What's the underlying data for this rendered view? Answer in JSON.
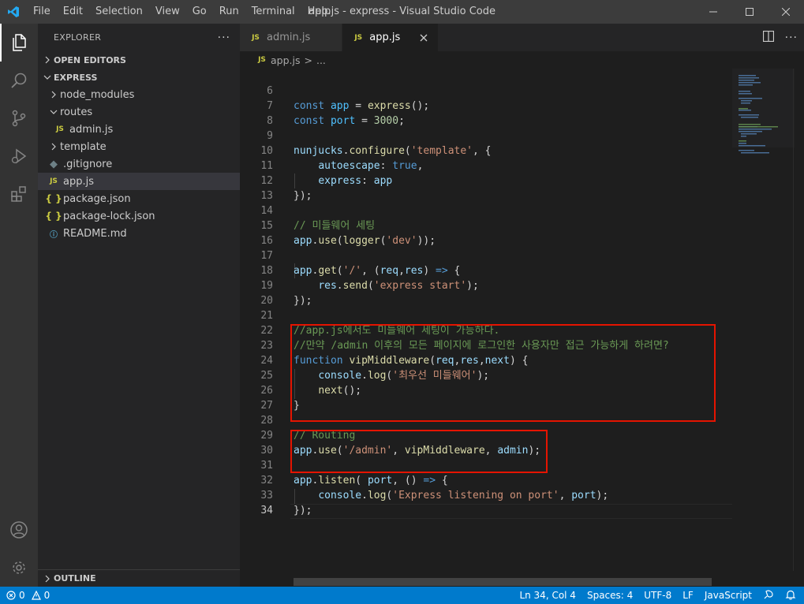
{
  "window": {
    "title": "app.js - express - Visual Studio Code",
    "menu": [
      "File",
      "Edit",
      "Selection",
      "View",
      "Go",
      "Run",
      "Terminal",
      "Help"
    ]
  },
  "sidebar": {
    "title": "EXPLORER",
    "more": "···",
    "open_editors": "OPEN EDITORS",
    "project": "EXPRESS",
    "items": [
      {
        "label": "node_modules",
        "type": "folder",
        "expanded": false
      },
      {
        "label": "routes",
        "type": "folder",
        "expanded": true
      },
      {
        "label": "admin.js",
        "type": "js"
      },
      {
        "label": "template",
        "type": "folder",
        "expanded": false
      },
      {
        "label": ".gitignore",
        "type": "git"
      },
      {
        "label": "app.js",
        "type": "js",
        "selected": true
      },
      {
        "label": "package.json",
        "type": "json"
      },
      {
        "label": "package-lock.json",
        "type": "json"
      },
      {
        "label": "README.md",
        "type": "info"
      }
    ],
    "outline": "OUTLINE",
    "js_badge": "JS",
    "json_badge": "{ }",
    "git_badge": "◆",
    "info_badge": "ⓘ"
  },
  "tabs": [
    {
      "label": "admin.js",
      "active": false
    },
    {
      "label": "app.js",
      "active": true
    }
  ],
  "breadcrumb": {
    "file": "app.js",
    "sep": ">",
    "rest": "..."
  },
  "editor": {
    "lines": [
      {
        "n": "6",
        "tokens": []
      },
      {
        "n": "7",
        "tokens": [
          [
            "kw",
            "const "
          ],
          [
            "var",
            "app"
          ],
          [
            "pl",
            " = "
          ],
          [
            "fn",
            "express"
          ],
          [
            "pl",
            "();"
          ]
        ]
      },
      {
        "n": "8",
        "tokens": [
          [
            "kw",
            "const "
          ],
          [
            "var",
            "port"
          ],
          [
            "pl",
            " = "
          ],
          [
            "num",
            "3000"
          ],
          [
            "pl",
            ";"
          ]
        ]
      },
      {
        "n": "9",
        "tokens": []
      },
      {
        "n": "10",
        "tokens": [
          [
            "prop",
            "nunjucks"
          ],
          [
            "pl",
            "."
          ],
          [
            "fn",
            "configure"
          ],
          [
            "pl",
            "("
          ],
          [
            "str",
            "'template'"
          ],
          [
            "pl",
            ", {"
          ]
        ]
      },
      {
        "n": "11",
        "tokens": [
          [
            "pl",
            "    "
          ],
          [
            "prop",
            "autoescape"
          ],
          [
            "pl",
            ": "
          ],
          [
            "kw",
            "true"
          ],
          [
            "pl",
            ","
          ]
        ]
      },
      {
        "n": "12",
        "tokens": [
          [
            "pl",
            "    "
          ],
          [
            "prop",
            "express"
          ],
          [
            "pl",
            ": "
          ],
          [
            "prop",
            "app"
          ]
        ]
      },
      {
        "n": "13",
        "tokens": [
          [
            "pl",
            "});"
          ]
        ]
      },
      {
        "n": "14",
        "tokens": []
      },
      {
        "n": "15",
        "tokens": [
          [
            "cm",
            "// 미들웨어 세팅"
          ]
        ]
      },
      {
        "n": "16",
        "tokens": [
          [
            "prop",
            "app"
          ],
          [
            "pl",
            "."
          ],
          [
            "fn",
            "use"
          ],
          [
            "pl",
            "("
          ],
          [
            "fn",
            "logger"
          ],
          [
            "pl",
            "("
          ],
          [
            "str",
            "'dev'"
          ],
          [
            "pl",
            "));"
          ]
        ]
      },
      {
        "n": "17",
        "tokens": []
      },
      {
        "n": "18",
        "tokens": [
          [
            "prop",
            "app"
          ],
          [
            "pl",
            "."
          ],
          [
            "fn",
            "get"
          ],
          [
            "pl",
            "("
          ],
          [
            "str",
            "'/'"
          ],
          [
            "pl",
            ", ("
          ],
          [
            "prop",
            "req"
          ],
          [
            "pl",
            ","
          ],
          [
            "prop",
            "res"
          ],
          [
            "pl",
            ") "
          ],
          [
            "kw",
            "=>"
          ],
          [
            "pl",
            " {"
          ]
        ]
      },
      {
        "n": "19",
        "tokens": [
          [
            "pl",
            "    "
          ],
          [
            "prop",
            "res"
          ],
          [
            "pl",
            "."
          ],
          [
            "fn",
            "send"
          ],
          [
            "pl",
            "("
          ],
          [
            "str",
            "'express start'"
          ],
          [
            "pl",
            ");"
          ]
        ]
      },
      {
        "n": "20",
        "tokens": [
          [
            "pl",
            "});"
          ]
        ]
      },
      {
        "n": "21",
        "tokens": []
      },
      {
        "n": "22",
        "tokens": [
          [
            "cm",
            "//app.js에서도 미들웨어 세팅이 가능하다."
          ]
        ]
      },
      {
        "n": "23",
        "tokens": [
          [
            "cm",
            "//만약 /admin 이후의 모든 페이지에 로그인한 사용자만 접근 가능하게 하려면?"
          ]
        ]
      },
      {
        "n": "24",
        "tokens": [
          [
            "kw",
            "function "
          ],
          [
            "fn",
            "vipMiddleware"
          ],
          [
            "pl",
            "("
          ],
          [
            "prop",
            "req"
          ],
          [
            "pl",
            ","
          ],
          [
            "prop",
            "res"
          ],
          [
            "pl",
            ","
          ],
          [
            "prop",
            "next"
          ],
          [
            "pl",
            ") {"
          ]
        ]
      },
      {
        "n": "25",
        "tokens": [
          [
            "pl",
            "    "
          ],
          [
            "prop",
            "console"
          ],
          [
            "pl",
            "."
          ],
          [
            "fn",
            "log"
          ],
          [
            "pl",
            "("
          ],
          [
            "str",
            "'최우선 미들웨어'"
          ],
          [
            "pl",
            ");"
          ]
        ]
      },
      {
        "n": "26",
        "tokens": [
          [
            "pl",
            "    "
          ],
          [
            "fn",
            "next"
          ],
          [
            "pl",
            "();"
          ]
        ]
      },
      {
        "n": "27",
        "tokens": [
          [
            "pl",
            "}"
          ]
        ]
      },
      {
        "n": "28",
        "tokens": []
      },
      {
        "n": "29",
        "tokens": [
          [
            "cm",
            "// Routing"
          ]
        ]
      },
      {
        "n": "30",
        "tokens": [
          [
            "prop",
            "app"
          ],
          [
            "pl",
            "."
          ],
          [
            "fn",
            "use"
          ],
          [
            "pl",
            "("
          ],
          [
            "str",
            "'/admin'"
          ],
          [
            "pl",
            ", "
          ],
          [
            "fn",
            "vipMiddleware"
          ],
          [
            "pl",
            ", "
          ],
          [
            "prop",
            "admin"
          ],
          [
            "pl",
            ");"
          ]
        ]
      },
      {
        "n": "31",
        "tokens": []
      },
      {
        "n": "32",
        "tokens": [
          [
            "prop",
            "app"
          ],
          [
            "pl",
            "."
          ],
          [
            "fn",
            "listen"
          ],
          [
            "pl",
            "( "
          ],
          [
            "prop",
            "port"
          ],
          [
            "pl",
            ", () "
          ],
          [
            "kw",
            "=>"
          ],
          [
            "pl",
            " {"
          ]
        ]
      },
      {
        "n": "33",
        "tokens": [
          [
            "pl",
            "    "
          ],
          [
            "prop",
            "console"
          ],
          [
            "pl",
            "."
          ],
          [
            "fn",
            "log"
          ],
          [
            "pl",
            "("
          ],
          [
            "str",
            "'Express listening on port'"
          ],
          [
            "pl",
            ", "
          ],
          [
            "prop",
            "port"
          ],
          [
            "pl",
            ");"
          ]
        ]
      },
      {
        "n": "34",
        "tokens": [
          [
            "pl",
            "});"
          ]
        ],
        "current": true
      }
    ]
  },
  "statusbar": {
    "errors": "0",
    "warnings": "0",
    "position": "Ln 34, Col 4",
    "spaces": "Spaces: 4",
    "encoding": "UTF-8",
    "eol": "LF",
    "language": "JavaScript"
  },
  "colors": {
    "accent": "#007acc",
    "highlight_box": "#e51400"
  }
}
